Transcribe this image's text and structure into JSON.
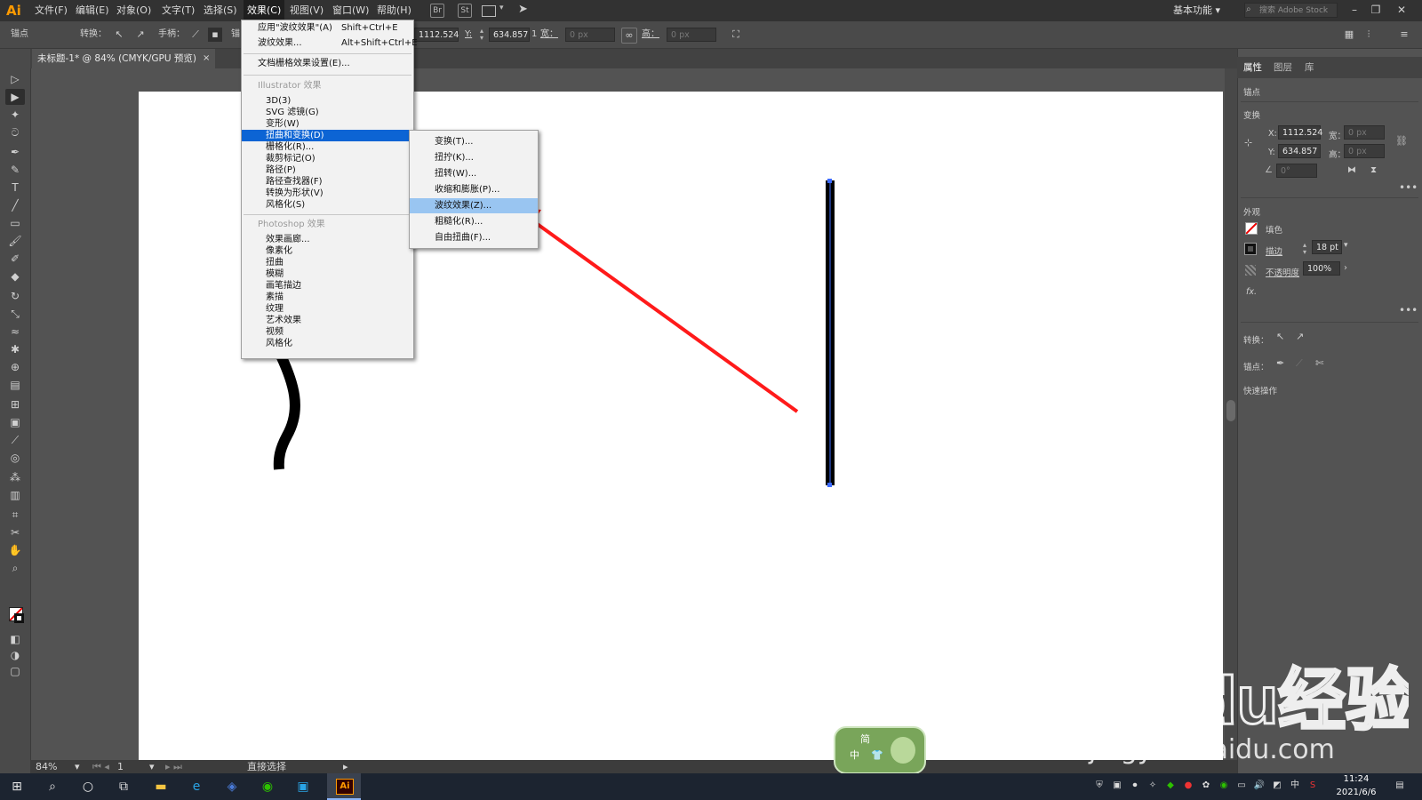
{
  "app": {
    "logo": "Ai"
  },
  "menubar": {
    "items": [
      "文件(F)",
      "编辑(E)",
      "对象(O)",
      "文字(T)",
      "选择(S)",
      "效果(C)",
      "视图(V)",
      "窗口(W)",
      "帮助(H)"
    ],
    "icons": [
      "Br",
      "St"
    ],
    "workspace": "基本功能",
    "search_placeholder": "搜索 Adobe Stock"
  },
  "controlbar": {
    "anchor_label": "锚点",
    "convert_label": "转换：",
    "handles_label": "手柄：",
    "anchors_label_partial": "锚",
    "x_value": "1112.524",
    "y_label": "Y:",
    "y_value": "634.857",
    "unit": "1",
    "width_label": "宽：",
    "width_value": "0 px",
    "height_label": "高：",
    "height_value": "0 px"
  },
  "document": {
    "tab_title": "未标题-1* @ 84% (CMYK/GPU 预览)",
    "close": "×"
  },
  "statusbar": {
    "zoom": "84%",
    "page": "1",
    "tool": "直接选择"
  },
  "effect_menu": {
    "top_items": [
      {
        "label": "应用\"波纹效果\"(A)",
        "shortcut": "Shift+Ctrl+E"
      },
      {
        "label": "波纹效果...",
        "shortcut": "Alt+Shift+Ctrl+E"
      }
    ],
    "doc_settings": "文档栅格效果设置(E)...",
    "illustrator_header": "Illustrator 效果",
    "illustrator_items": [
      "3D(3)",
      "SVG 滤镜(G)",
      "变形(W)",
      "扭曲和变换(D)",
      "栅格化(R)...",
      "裁剪标记(O)",
      "路径(P)",
      "路径查找器(F)",
      "转换为形状(V)",
      "风格化(S)"
    ],
    "photoshop_header": "Photoshop 效果",
    "photoshop_items": [
      "效果画廊...",
      "像素化",
      "扭曲",
      "模糊",
      "画笔描边",
      "素描",
      "纹理",
      "艺术效果",
      "视频",
      "风格化"
    ]
  },
  "submenu": {
    "items": [
      "变换(T)...",
      "扭拧(K)...",
      "扭转(W)...",
      "收缩和膨胀(P)...",
      "波纹效果(Z)...",
      "粗糙化(R)...",
      "自由扭曲(F)..."
    ],
    "highlighted": "波纹效果(Z)..."
  },
  "panel": {
    "tabs": [
      "属性",
      "图层",
      "库"
    ],
    "anchor_header": "锚点",
    "transform_header": "变换",
    "x_label": "X:",
    "x_value": "1112.524",
    "y_label": "Y:",
    "y_value": "634.857",
    "w_label": "宽：",
    "w_value": "0 px",
    "h_label": "高：",
    "h_value": "0 px",
    "angle_value": "0°",
    "appearance_header": "外观",
    "fill_label": "填色",
    "stroke_label": "描边",
    "stroke_value": "18 pt",
    "opacity_label": "不透明度",
    "opacity_value": "100%",
    "fx_label": "fx.",
    "convert_label": "转换：",
    "anchor_label": "锚点：",
    "quick_actions": "快速操作"
  },
  "taskbar": {
    "time": "11:24",
    "date": "2021/6/6",
    "ime": "中",
    "app_label": "Ai"
  },
  "ime_badge": {
    "line1": "简",
    "line2": "中"
  },
  "watermark": {
    "text": "Baidu经验",
    "subtext": "jingyan.baidu.com"
  },
  "colors": {
    "highlight": "#0c64d4",
    "submenu_highlight": "#99c5f1",
    "arrow": "#ff1a1a",
    "ai_orange": "#ff9a00"
  }
}
